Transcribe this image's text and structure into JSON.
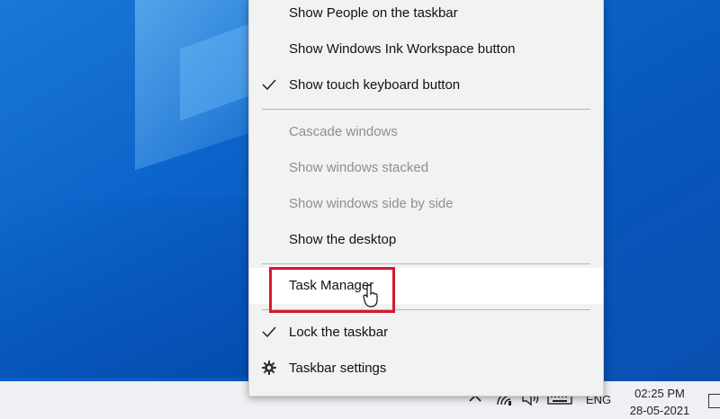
{
  "menu": {
    "items": [
      {
        "label": "Show People on the taskbar",
        "checked": false,
        "disabled": false
      },
      {
        "label": "Show Windows Ink Workspace button",
        "checked": false,
        "disabled": false
      },
      {
        "label": "Show touch keyboard button",
        "checked": true,
        "disabled": false
      },
      {
        "label": "Cascade windows",
        "checked": false,
        "disabled": true
      },
      {
        "label": "Show windows stacked",
        "checked": false,
        "disabled": true
      },
      {
        "label": "Show windows side by side",
        "checked": false,
        "disabled": true
      },
      {
        "label": "Show the desktop",
        "checked": false,
        "disabled": false
      },
      {
        "label": "Task Manager",
        "checked": false,
        "disabled": false,
        "hovered": true
      },
      {
        "label": "Lock the taskbar",
        "checked": true,
        "disabled": false
      },
      {
        "label": "Taskbar settings",
        "icon": "gear-icon",
        "disabled": false
      }
    ]
  },
  "taskbar": {
    "language": "ENG",
    "time": "02:25 PM",
    "date": "28-05-2021",
    "tray_icons": [
      "chevron-up-icon",
      "wifi-icon",
      "speaker-icon",
      "keyboard-icon"
    ]
  },
  "colors": {
    "highlight": "#d51a2a",
    "desktop": "#0b63c9",
    "menu_bg": "#f2f2f2"
  }
}
